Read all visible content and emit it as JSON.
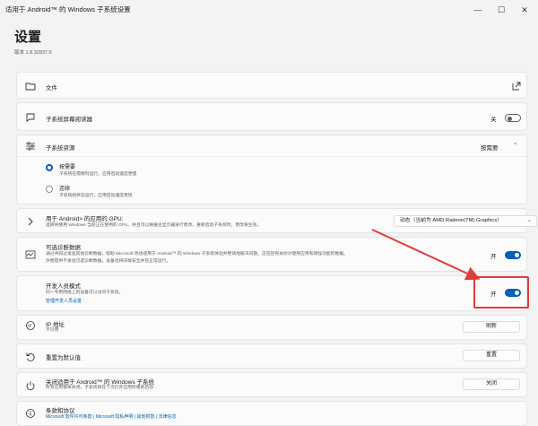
{
  "window": {
    "title": "适用于 Android™ 的 Windows 子系统设置"
  },
  "header": {
    "title": "设置",
    "version": "版本 1.8.32837.0"
  },
  "files": {
    "label": "文件"
  },
  "screen_reader": {
    "label": "子系统屏幕阅读器",
    "toggle_text": "关"
  },
  "resources": {
    "label": "子系统资源",
    "value": "按需要",
    "options": [
      {
        "label": "按需要",
        "desc": "子系统在需要时运行，应用启动速度更慢"
      },
      {
        "label": "连续",
        "desc": "子系统始终在运行，应用启动速度更快"
      }
    ]
  },
  "gpu": {
    "label": "用于 Android> 的应用的 GPU:",
    "desc": "选择将使用 Windows 当前正在使用的 GPU。并且可以根据主显示器进行更改。重新启动子系统时，更改将生效。",
    "selected": "动态（当前为 AMD Radeon(TM) Graphics）"
  },
  "diagnostics": {
    "label": "可选诊断数据",
    "desc1": "通过共同过发送其他诊断数据，帮助 Microsoft 改进适用于 Android™ 的 Windows 子系统体验并更快地解决问题。这包括有关你对使用应用和增强功能的数据。",
    "desc2": "你想提供不发送可选诊断数据，设备也将同样安全并且正常运行。",
    "toggle_text": "开"
  },
  "developer": {
    "label": "开发人员模式",
    "desc": "同一专用网络上的设备可以访问子系统。",
    "link": "管理开发人员设置",
    "toggle_text": "开"
  },
  "ip": {
    "label": "IP 地址",
    "value": "不可用",
    "button": "刷新"
  },
  "reset": {
    "label": "重置为默认值",
    "button": "重置"
  },
  "shutdown": {
    "label": "关闭适用于 Android™ 的 Windows 子系统",
    "desc": "所有应用都将关闭。子系统将在下次打开应用时重新启动",
    "button": "关闭"
  },
  "terms": {
    "label": "条款和协议",
    "links": "Microsoft 软件许可条款 | Microsoft 隐私声明 | 其他附款 | 法律信息"
  },
  "colors": {
    "accent": "#005fb8",
    "annotation": "#e23b3b"
  }
}
